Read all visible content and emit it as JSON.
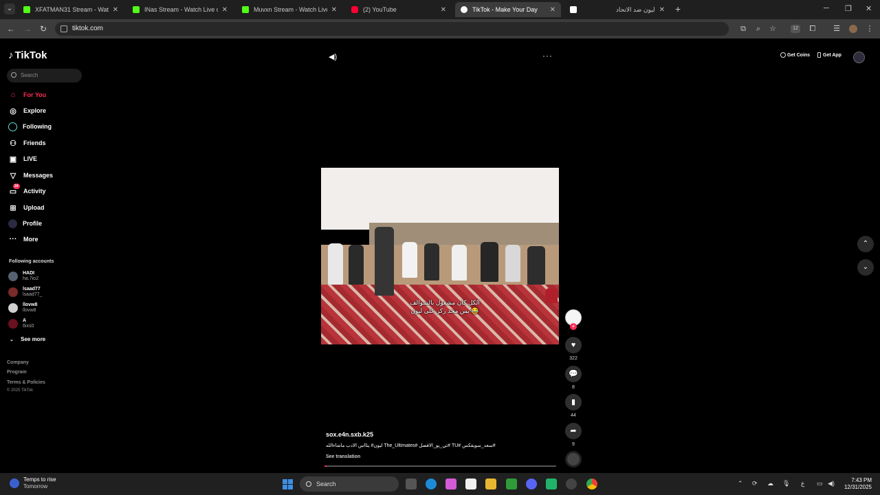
{
  "browser": {
    "tabs": [
      {
        "label": "XFATMAN31 Stream - Watch Li",
        "favicon_color": "#53fc18",
        "active": false
      },
      {
        "label": "INas Stream - Watch Live on Ki",
        "favicon_color": "#53fc18",
        "active": false
      },
      {
        "label": "Muvxn Stream - Watch Live on",
        "favicon_color": "#53fc18",
        "active": false
      },
      {
        "label": "(2) YouTube",
        "favicon_color": "#ff0033",
        "active": false
      },
      {
        "label": "TikTok - Make Your Day",
        "favicon_color": "#ffffff",
        "active": true
      },
      {
        "label": "ليون ضد الاتحاد",
        "favicon_color": "#ffffff",
        "active": false
      }
    ],
    "url": "tiktok.com",
    "extension_badge": "12"
  },
  "sidebar": {
    "logo": "TikTok",
    "search_placeholder": "Search",
    "nav": [
      {
        "label": "For You",
        "icon": "home-icon",
        "active": true
      },
      {
        "label": "Explore",
        "icon": "compass-icon",
        "active": false
      },
      {
        "label": "Following",
        "icon": "following-icon",
        "active": false
      },
      {
        "label": "Friends",
        "icon": "friends-icon",
        "active": false
      },
      {
        "label": "LIVE",
        "icon": "live-icon",
        "active": false
      },
      {
        "label": "Messages",
        "icon": "messages-icon",
        "active": false
      },
      {
        "label": "Activity",
        "icon": "activity-icon",
        "active": false,
        "badge": "24"
      },
      {
        "label": "Upload",
        "icon": "upload-icon",
        "active": false
      },
      {
        "label": "Profile",
        "icon": "profile-icon",
        "active": false
      },
      {
        "label": "More",
        "icon": "more-icon",
        "active": false
      }
    ],
    "following_title": "Following accounts",
    "accounts": [
      {
        "name": "HADI",
        "handle": "ha.7io2",
        "avatar_color": "#556070"
      },
      {
        "name": "lsaad77",
        "handle": "lsaad77_",
        "avatar_color": "#7a2a2a"
      },
      {
        "name": "llovw8",
        "handle": "llovw8",
        "avatar_color": "#cfcfcf"
      },
      {
        "name": "A",
        "handle": "6ixs0",
        "avatar_color": "#6a1020"
      }
    ],
    "see_more": "See more",
    "footer": [
      "Company",
      "Program",
      "Terms & Policies"
    ],
    "copyright": "© 2025 TikTok"
  },
  "header": {
    "get_coins": "Get Coins",
    "get_app": "Get App"
  },
  "video": {
    "subtitle_line1": "الكل كان مشغول بالسوالف",
    "subtitle_line2": "بس محد ركز على ليون 😂",
    "author": "sox.e4n.sxb.k25",
    "caption": "ليون# يتااس الادب ماشاءالله The_Ultimates# تي_يو_الافضل# TU# سعد_سويفكس#",
    "see_translation": "See translation",
    "progress": 0.01
  },
  "actions": {
    "likes": "322",
    "comments": "8",
    "saves": "44",
    "shares": "9"
  },
  "taskbar": {
    "weather_line1": "Temps to rise",
    "weather_line2": "Tomorrow",
    "search": "Search",
    "time": "7:43 PM",
    "date": "12/31/2025",
    "lang": "ع"
  }
}
